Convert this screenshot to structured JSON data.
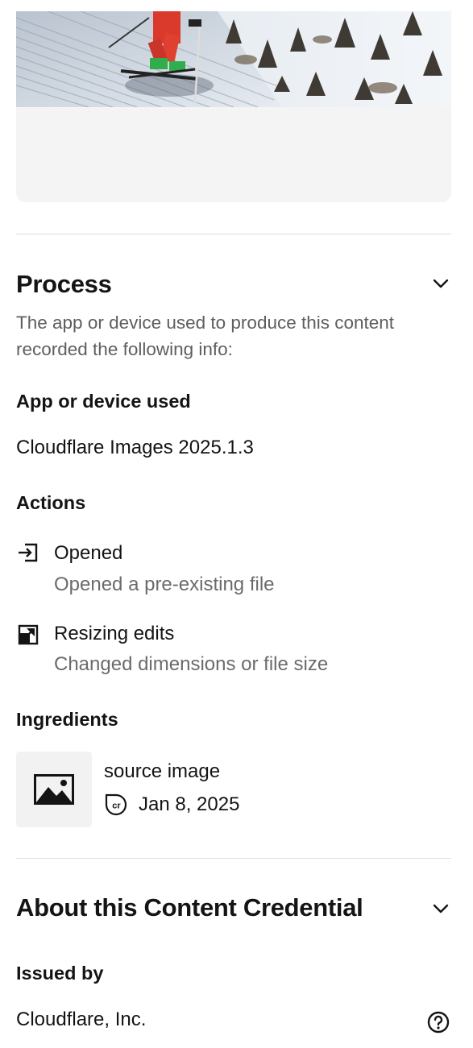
{
  "hero": {
    "icon": "photo-skier-on-snowy-slope"
  },
  "process": {
    "title": "Process",
    "description": "The app or device used to produce this content recorded the following info:",
    "app_label": "App or device used",
    "app_value": "Cloudflare Images 2025.1.3",
    "actions_label": "Actions",
    "actions": [
      {
        "title": "Opened",
        "description": "Opened a pre-existing file",
        "icon": "open-file-icon"
      },
      {
        "title": "Resizing edits",
        "description": "Changed dimensions or file size",
        "icon": "resize-icon"
      }
    ],
    "ingredients_label": "Ingredients",
    "ingredient": {
      "name": "source image",
      "date": "Jan 8, 2025",
      "thumb_icon": "image-icon",
      "badge_icon": "content-credentials-icon"
    }
  },
  "about": {
    "title": "About this Content Credential",
    "issued_by_label": "Issued by",
    "issuer": "Cloudflare, Inc.",
    "help_icon": "help-icon"
  }
}
